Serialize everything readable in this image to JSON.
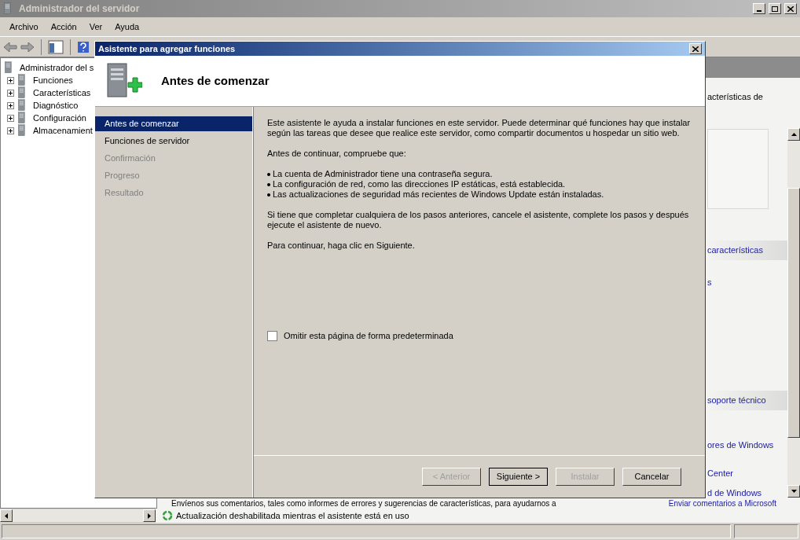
{
  "window": {
    "title": "Administrador del servidor"
  },
  "menu": [
    "Archivo",
    "Acción",
    "Ver",
    "Ayuda"
  ],
  "tree": {
    "root": "Administrador del s",
    "items": [
      {
        "label": "Funciones"
      },
      {
        "label": "Características"
      },
      {
        "label": "Diagnóstico"
      },
      {
        "label": "Configuración"
      },
      {
        "label": "Almacenamient"
      }
    ]
  },
  "right_pane": {
    "summary_text": "acterísticas de",
    "section_1": "características",
    "link_1": "s",
    "section_2": "soporte técnico",
    "links_2": [
      "ores de Windows",
      "Center",
      "d de Windows"
    ],
    "feedback_text": "Envíenos sus comentarios, tales como informes de errores y sugerencias de características, para ayudarnos a",
    "feedback_link": "Enviar comentarios a Microsoft"
  },
  "dialog": {
    "title": "Asistente para agregar funciones",
    "header": "Antes de comenzar",
    "steps": [
      {
        "label": "Antes de comenzar",
        "selected": true,
        "disabled": false
      },
      {
        "label": "Funciones de servidor",
        "selected": false,
        "disabled": false
      },
      {
        "label": "Confirmación",
        "selected": false,
        "disabled": true
      },
      {
        "label": "Progreso",
        "selected": false,
        "disabled": true
      },
      {
        "label": "Resultado",
        "selected": false,
        "disabled": true
      }
    ],
    "intro": "Este asistente le ayuda a instalar funciones en este servidor. Puede determinar qué funciones hay que instalar según las tareas que desee que realice este servidor, como compartir documentos u hospedar un sitio web.",
    "check_heading": "Antes de continuar, compruebe que:",
    "bullets": [
      "La cuenta de Administrador tiene una contraseña segura.",
      "La configuración de red, como las direcciones IP estáticas, está establecida.",
      "Las actualizaciones de seguridad más recientes de Windows Update están instaladas."
    ],
    "note": "Si tiene que completar cualquiera de los pasos anteriores, cancele el asistente, complete los pasos y después ejecute el asistente de nuevo.",
    "continue_text": "Para continuar, haga clic en Siguiente.",
    "checkbox": {
      "label": "Omitir esta página de forma predeterminada",
      "checked": false
    },
    "buttons": [
      {
        "label": "< Anterior",
        "disabled": true,
        "default": false
      },
      {
        "label": "Siguiente >",
        "disabled": false,
        "default": true
      },
      {
        "label": "Instalar",
        "disabled": true,
        "default": false
      },
      {
        "label": "Cancelar",
        "disabled": false,
        "default": false
      }
    ]
  },
  "status_message": "Actualización deshabilitada mientras el asistente está en uso"
}
